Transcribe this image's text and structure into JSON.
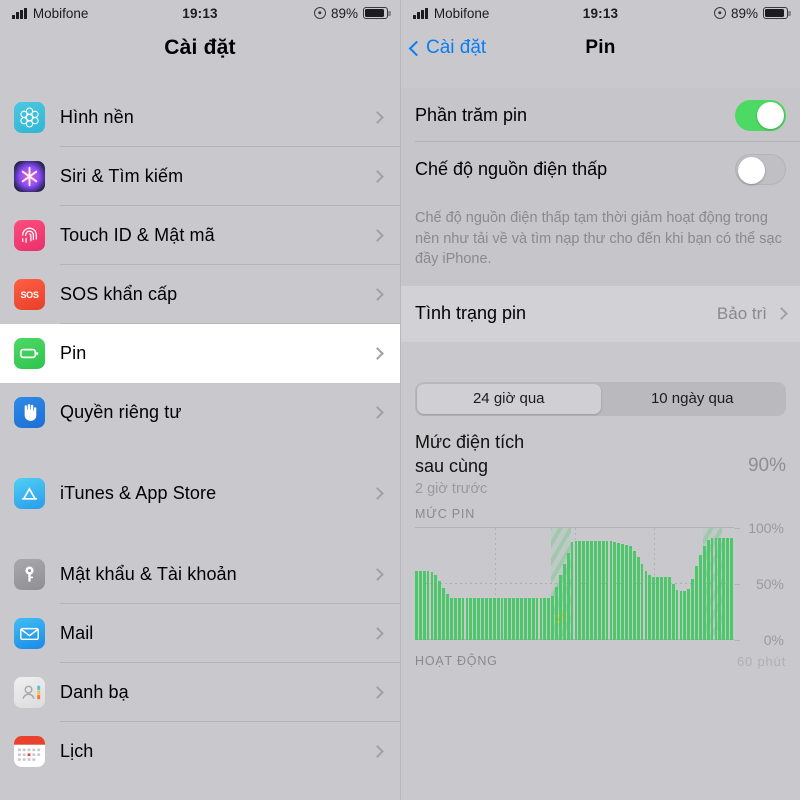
{
  "status_bar": {
    "carrier": "Mobifone",
    "time": "19:13",
    "battery_percent": "89%",
    "signal_icon": "signal-bars-icon",
    "location_icon": "location-services-icon",
    "battery_icon": "battery-full-icon"
  },
  "left_panel": {
    "title": "Cài đặt",
    "groups": [
      {
        "items": [
          {
            "label": "Hình nền",
            "icon": "wallpaper-icon",
            "selected": false
          },
          {
            "label": "Siri & Tìm kiếm",
            "icon": "siri-icon",
            "selected": false
          },
          {
            "label": "Touch ID & Mật mã",
            "icon": "touch-id-icon",
            "selected": false
          },
          {
            "label": "SOS khẩn cấp",
            "icon": "sos-icon",
            "selected": false
          },
          {
            "label": "Pin",
            "icon": "battery-icon",
            "selected": true
          },
          {
            "label": "Quyền riêng tư",
            "icon": "privacy-hand-icon",
            "selected": false
          }
        ]
      },
      {
        "items": [
          {
            "label": "iTunes & App Store",
            "icon": "app-store-icon",
            "selected": false
          }
        ]
      },
      {
        "items": [
          {
            "label": "Mật khẩu & Tài khoản",
            "icon": "key-icon",
            "selected": false
          },
          {
            "label": "Mail",
            "icon": "mail-icon",
            "selected": false
          },
          {
            "label": "Danh bạ",
            "icon": "contacts-icon",
            "selected": false
          },
          {
            "label": "Lịch",
            "icon": "calendar-icon",
            "selected": false
          }
        ]
      }
    ]
  },
  "right_panel": {
    "back_label": "Cài đặt",
    "title": "Pin",
    "rows": [
      {
        "label": "Phần trăm pin",
        "toggle": "on"
      },
      {
        "label": "Chế độ nguồn điện thấp",
        "toggle": "off"
      }
    ],
    "footnote": "Chế độ nguồn điện thấp tạm thời giảm hoạt động trong nền như tải về và tìm nạp thư cho đến khi bạn có thể sạc đầy iPhone.",
    "battery_health": {
      "label": "Tình trạng pin",
      "value": "Bảo trì"
    },
    "segmented": {
      "options": [
        "24 giờ qua",
        "10 ngày qua"
      ],
      "active_index": 0
    },
    "last_charge": {
      "title_line1": "Mức điện tích",
      "title_line2": "sau cùng",
      "subtitle": "2 giờ trước",
      "value": "90%"
    },
    "chart_section_title": "MỨC PIN",
    "activity_section_title": "HOẠT ĐỘNG",
    "activity_value": "60 phút"
  },
  "colors": {
    "accent_blue": "#0a7cf5",
    "toggle_on_green": "#4cd964",
    "bar_green": "#4cc76a",
    "panel_bg": "#c9c9cd",
    "selected_row": "#ffffff"
  },
  "chart_data": {
    "type": "bar",
    "title": "MỨC PIN",
    "xlabel": "",
    "ylabel": "",
    "ylim": [
      0,
      100
    ],
    "ytick_labels": [
      "100%",
      "50%",
      "0%"
    ],
    "ytick_values": [
      100,
      50,
      0
    ],
    "grid": true,
    "legend": null,
    "annotations": [
      {
        "type": "charging-band",
        "start_index": 35,
        "end_index": 39,
        "label": "charging-bolt-icon"
      },
      {
        "type": "charging-band",
        "start_index": 74,
        "end_index": 78
      }
    ],
    "values": [
      62,
      62,
      62,
      62,
      61,
      58,
      53,
      47,
      41,
      38,
      38,
      38,
      38,
      38,
      38,
      38,
      38,
      38,
      38,
      38,
      38,
      38,
      38,
      38,
      38,
      38,
      38,
      38,
      38,
      38,
      38,
      38,
      38,
      38,
      38,
      40,
      48,
      58,
      68,
      78,
      88,
      89,
      89,
      89,
      89,
      89,
      89,
      89,
      89,
      89,
      89,
      88,
      87,
      86,
      85,
      84,
      80,
      74,
      68,
      62,
      58,
      57,
      57,
      57,
      57,
      57,
      50,
      45,
      44,
      44,
      46,
      55,
      66,
      76,
      84,
      90,
      91,
      91,
      91,
      91,
      91,
      91
    ]
  }
}
